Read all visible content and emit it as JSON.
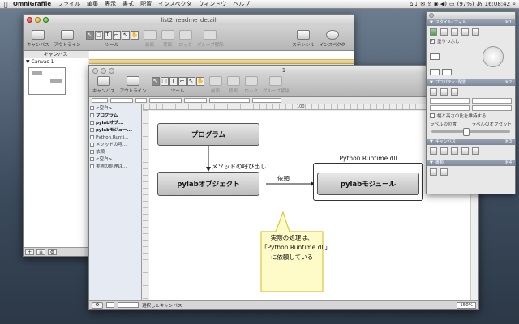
{
  "menubar": {
    "app_name": "OmniGraffle",
    "items": [
      "ファイル",
      "編集",
      "表示",
      "書式",
      "配置",
      "インスペクタ",
      "ウィンドウ",
      "ヘルプ"
    ],
    "battery": "(97%)",
    "input_method": "あ",
    "clock": "16:08:42"
  },
  "back_window": {
    "title": "list2_readme_detail",
    "toolbar": {
      "canvas_label": "キャンバス",
      "outline_label": "アウトライン",
      "tools_label": "ツール",
      "group_label": "前面",
      "ungroup_label": "背面",
      "lock_label": "ロック",
      "group_ungroup_label": "グループ解除",
      "stencil_label": "ステンシル",
      "inspector_label": "インスペクタ"
    },
    "sidebar": {
      "header": "キャンバス",
      "canvas_name": "Canvas 1"
    }
  },
  "front_window": {
    "title": "1",
    "toolbar": {
      "canvas_label": "キャンバス",
      "outline_label": "アウトライン",
      "tools_label": "ツール",
      "group_label": "前面",
      "ungroup_label": "背面",
      "lock_label": "ロック",
      "group_ungroup_label": "グループ解除"
    },
    "ruler_mark": "100",
    "outline_items": [
      {
        "label": "<空白>",
        "bold": false
      },
      {
        "label": "プログラム",
        "bold": true
      },
      {
        "label": "pylabオブ...",
        "bold": true
      },
      {
        "label": "pylabモジュー...",
        "bold": true
      },
      {
        "label": "Python.Runti...",
        "bold": false
      },
      {
        "label": "メソッドの呼...",
        "bold": false
      },
      {
        "label": "依頼",
        "bold": false
      },
      {
        "label": "<空白>",
        "bold": false
      },
      {
        "label": "実際の処理は...",
        "bold": false
      }
    ],
    "status": {
      "selection": "選択したキャンバス",
      "zoom": "150%"
    }
  },
  "diagram": {
    "program": "プログラム",
    "method_call": "メソッドの呼び出し",
    "pylab_object": "pylabオブジェクト",
    "request": "依頼",
    "runtime_group": "Python.Runtime.dll",
    "pylab_module": "pylabモジュール",
    "callout_line1": "実際の処理は、",
    "callout_line2": "「Python.Runtime.dll」",
    "callout_line3": "に依頼している"
  },
  "inspector": {
    "section_style": "スタイル: フィル",
    "fill_label": "塗りつぶし",
    "section_properties": "プロパティ: 配置",
    "wrap_label": "幅と高さの比を維持する",
    "label_position": "ラベルの位置",
    "label_offset": "ラベルのオフセット",
    "section_canvas": "キャンバス",
    "section_document": "書類",
    "shortcut_style": "⌘1",
    "shortcut_properties": "⌘2",
    "shortcut_canvas": "⌘3",
    "shortcut_document": "⌘4"
  },
  "colors": {
    "shape_fill": "#c8c8c8",
    "callout_fill": "#fffbc8",
    "callout_border": "#d8c840",
    "ruler_strip": "#f3dc98"
  }
}
